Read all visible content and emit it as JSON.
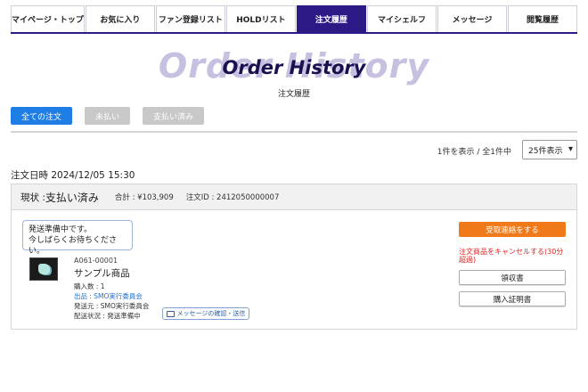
{
  "nav": {
    "tabs": [
      {
        "label": "マイページ・トップ",
        "active": false
      },
      {
        "label": "お気に入り",
        "active": false
      },
      {
        "label": "ファン登録リスト",
        "active": false
      },
      {
        "label": "HOLDリスト",
        "active": false
      },
      {
        "label": "注文履歴",
        "active": true
      },
      {
        "label": "マイシェルフ",
        "active": false
      },
      {
        "label": "メッセージ",
        "active": false
      },
      {
        "label": "閲覧履歴",
        "active": false
      }
    ]
  },
  "header": {
    "bg_title": "Order History",
    "title": "Order History",
    "subtitle": "注文履歴"
  },
  "filters": {
    "all": "全ての注文",
    "unpaid": "未払い",
    "paid": "支払い済み"
  },
  "pager": {
    "count_text": "1件を表示 / 全1件中",
    "per_page": "25件表示"
  },
  "order": {
    "date_text": "注文日時 2024/12/05 15:30",
    "status_label": "現状 : ",
    "status_value": "支払い済み",
    "total_text": "合計 : ¥103,909",
    "id_text": "注文ID : 2412050000007",
    "notice_line1": "発送準備中です。",
    "notice_line2": "今しばらくお待ちください。",
    "item": {
      "code": "A061-00001",
      "name": "サンプル商品",
      "quantity": "購入数 : 1",
      "seller": "出品 : SMO実行委員会",
      "shipper": "発送元 : SMO実行委員会",
      "delivery": "配送状況 : 発送準備中"
    },
    "message_button": "メッセージの確認・送信",
    "actions": {
      "contact": "受取連絡をする",
      "cancel": "注文商品をキャンセルする(30分超過)",
      "receipt": "領収書",
      "certificate": "購入証明書"
    }
  },
  "colors": {
    "nav_active": "#2e1a87",
    "filter_active": "#1e7ee6",
    "orange": "#f07a1a",
    "cancel_red": "#e02020"
  }
}
